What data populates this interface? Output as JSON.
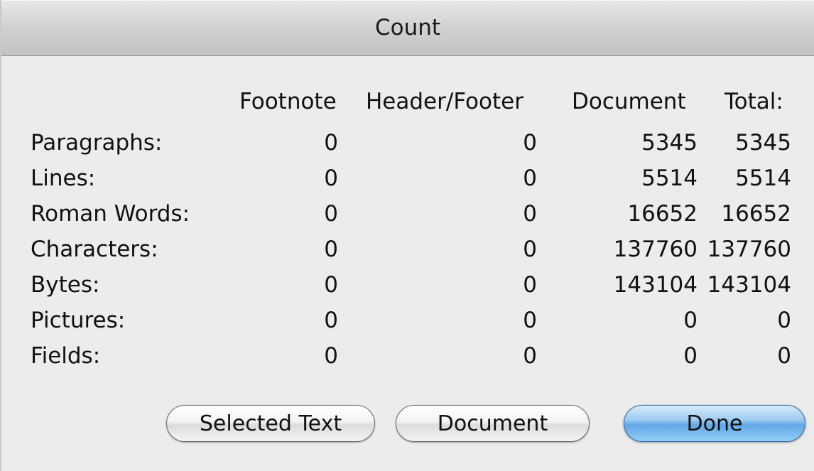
{
  "window": {
    "title": "Count"
  },
  "columns": {
    "footnote": "Footnote",
    "header_footer": "Header/Footer",
    "document": "Document",
    "total": "Total:"
  },
  "rows": [
    {
      "label": "Paragraphs:",
      "footnote": "0",
      "header_footer": "0",
      "document": "5345",
      "total": "5345"
    },
    {
      "label": "Lines:",
      "footnote": "0",
      "header_footer": "0",
      "document": "5514",
      "total": "5514"
    },
    {
      "label": "Roman Words:",
      "footnote": "0",
      "header_footer": "0",
      "document": "16652",
      "total": "16652"
    },
    {
      "label": "Characters:",
      "footnote": "0",
      "header_footer": "0",
      "document": "137760",
      "total": "137760"
    },
    {
      "label": "Bytes:",
      "footnote": "0",
      "header_footer": "0",
      "document": "143104",
      "total": "143104"
    },
    {
      "label": "Pictures:",
      "footnote": "0",
      "header_footer": "0",
      "document": "0",
      "total": "0"
    },
    {
      "label": "Fields:",
      "footnote": "0",
      "header_footer": "0",
      "document": "0",
      "total": "0"
    }
  ],
  "buttons": {
    "selected_text": "Selected Text",
    "document": "Document",
    "done": "Done"
  },
  "colors": {
    "window_bg": "#ececec",
    "default_button": "#63a7e6"
  }
}
